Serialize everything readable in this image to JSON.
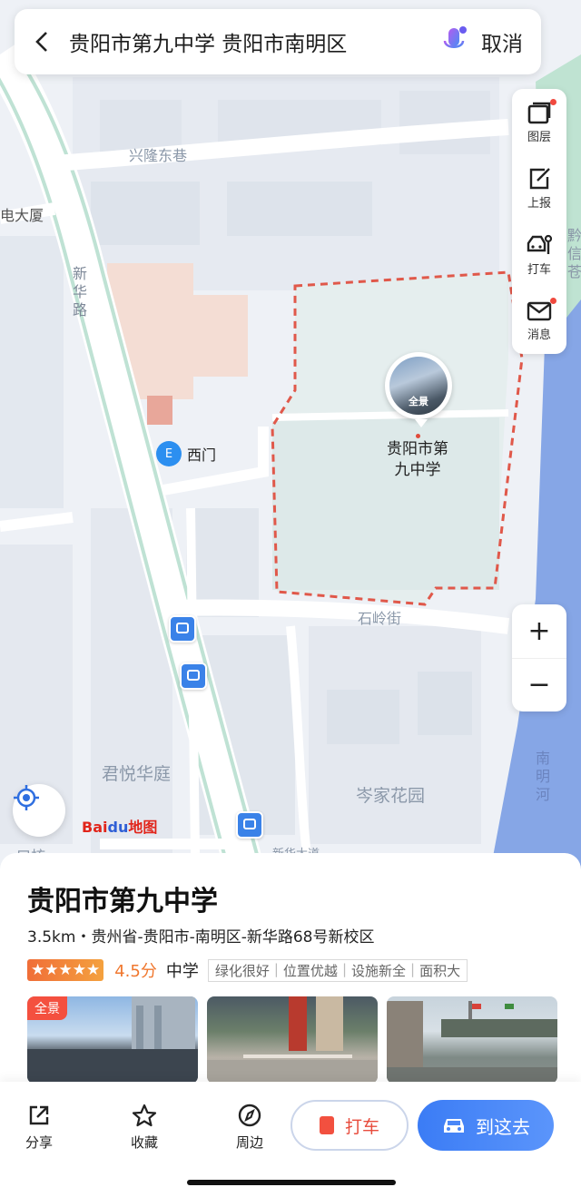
{
  "search": {
    "query": "贵阳市第九中学 贵阳市南明区",
    "cancel_label": "取消"
  },
  "toolbar": {
    "items": [
      {
        "label": "图层",
        "icon": "layers-icon",
        "has_dot": true
      },
      {
        "label": "上报",
        "icon": "report-edit-icon",
        "has_dot": false
      },
      {
        "label": "打车",
        "icon": "taxi-icon",
        "has_dot": false
      },
      {
        "label": "消息",
        "icon": "message-mail-icon",
        "has_dot": true
      }
    ]
  },
  "zoom": {
    "in": "+",
    "out": "−"
  },
  "map": {
    "labels": {
      "xinglong": "兴隆东巷",
      "dasha": "电大厦",
      "xinhua_road": "新\n华\n路",
      "shiling": "石岭街",
      "junyue": "君悦华庭",
      "cenjia": "岑家花园",
      "nanming_river": "南\n明\n河",
      "right_edge": "黔\n信\n苍",
      "bottom_left": "口核",
      "bottom_mid": "新华大道"
    },
    "poi_title": "贵阳市第\n九中学",
    "pano_tag": "全景",
    "gate": {
      "icon_text": "E",
      "label": "西门"
    },
    "logo": {
      "part1": "Bai",
      "part2": "du",
      "part3": "地图"
    }
  },
  "place": {
    "name": "贵阳市第九中学",
    "address": "3.5km・贵州省-贵阳市-南明区-新华路68号新校区",
    "stars": "★★★★★",
    "score": "4.5分",
    "category": "中学",
    "tags": [
      "绿化很好",
      "位置优越",
      "设施新全",
      "面积大"
    ],
    "photo_label": "全景"
  },
  "actions": {
    "share": "分享",
    "favorite": "收藏",
    "nearby": "周边",
    "taxi": "打车",
    "go": "到这去"
  },
  "colors": {
    "accent": "#3b7cf5",
    "boundary": "#e0584a",
    "river": "#86a6e6"
  }
}
